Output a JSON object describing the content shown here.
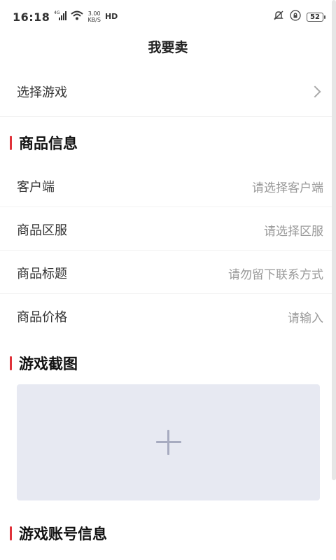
{
  "status_bar": {
    "time": "16:18",
    "network_label": "4G",
    "speed_value": "3.00",
    "speed_unit": "KB/S",
    "hd_label": "HD",
    "battery": "52"
  },
  "header": {
    "title": "我要卖"
  },
  "select_game": {
    "label": "选择游戏"
  },
  "sections": {
    "product_info": "商品信息",
    "screenshots": "游戏截图",
    "account_info": "游戏账号信息"
  },
  "fields": {
    "client": {
      "label": "客户端",
      "placeholder": "请选择客户端"
    },
    "server": {
      "label": "商品区服",
      "placeholder": "请选择区服"
    },
    "title": {
      "label": "商品标题",
      "placeholder": "请勿留下联系方式"
    },
    "price": {
      "label": "商品价格",
      "placeholder": "请输入"
    }
  },
  "icons": {
    "upload": "plus-icon",
    "chevron": "chevron-right-icon",
    "bell_muted": "bell-muted-icon",
    "lock": "lock-icon"
  },
  "colors": {
    "accent": "#e0323a",
    "upload_bg": "#e7e9f2"
  }
}
